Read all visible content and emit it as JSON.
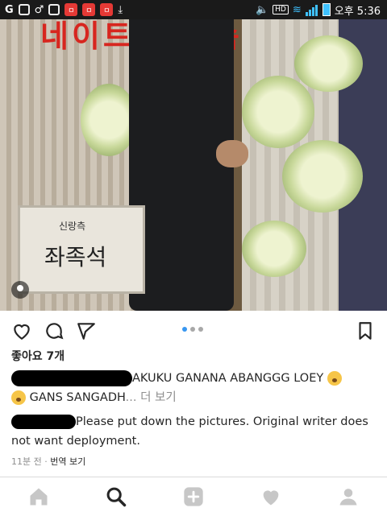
{
  "status_bar": {
    "hd_label": "HD",
    "time": "오후 5:36",
    "app_badges": [
      "ㅁ",
      "ㅁ",
      "ㅁ"
    ]
  },
  "photo": {
    "banner_text": "네이트판 폭속",
    "nameplate_small": "신랑측",
    "nameplate_name": "좌족석"
  },
  "post": {
    "likes": "좋아요 7개",
    "caption_text_1": "AKUKU GANANA ABANGGG LOEY",
    "caption_text_2": " GANS SANGADH",
    "more_label": "... 더 보기",
    "comment_text": "Please put down the pictures. Original writer does not want deployment.",
    "time_ago": "11분 전",
    "meta_separator": " · ",
    "translate_label": "번역 보기"
  },
  "carousel": {
    "current_index": 1,
    "total": 3
  },
  "icons": [
    "heart-icon",
    "comment-icon",
    "share-icon",
    "bookmark-icon",
    "home-icon",
    "search-icon",
    "add-icon",
    "activity-heart-icon",
    "profile-icon"
  ],
  "colors": {
    "accent_blue": "#3897f0",
    "text": "#262626",
    "muted": "#8e8e8e"
  }
}
